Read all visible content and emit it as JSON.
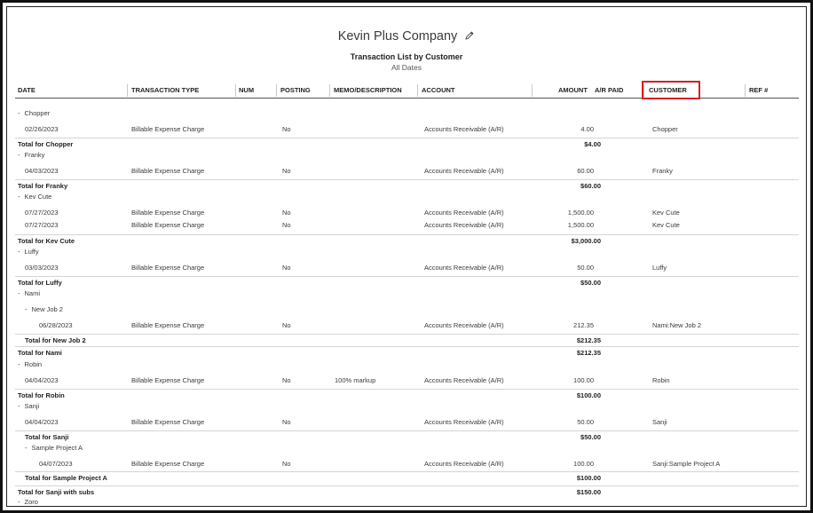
{
  "report": {
    "company": "Kevin Plus Company",
    "title": "Transaction List by Customer",
    "subtitle": "All Dates"
  },
  "columns": {
    "date": "DATE",
    "type": "TRANSACTION TYPE",
    "num": "NUM",
    "posting": "POSTING",
    "memo": "MEMO/DESCRIPTION",
    "account": "ACCOUNT",
    "amount": "AMOUNT",
    "ap": "A/R PAID",
    "customer": "CUSTOMER",
    "ref": "REF #"
  },
  "rows": [
    {
      "kind": "group",
      "indent": 0,
      "label": "Chopper"
    },
    {
      "kind": "txn",
      "indent": 0,
      "date": "02/26/2023",
      "type": "Billable Expense Charge",
      "posting": "No",
      "memo": "",
      "account": "Accounts Receivable (A/R)",
      "amount": "4.00",
      "customer": "Chopper"
    },
    {
      "kind": "total",
      "indent": 0,
      "label": "Total for Chopper",
      "amount": "$4.00"
    },
    {
      "kind": "group",
      "indent": 0,
      "label": "Franky"
    },
    {
      "kind": "txn",
      "indent": 0,
      "date": "04/03/2023",
      "type": "Billable Expense Charge",
      "posting": "No",
      "memo": "",
      "account": "Accounts Receivable (A/R)",
      "amount": "60.00",
      "customer": "Franky"
    },
    {
      "kind": "total",
      "indent": 0,
      "label": "Total for Franky",
      "amount": "$60.00"
    },
    {
      "kind": "group",
      "indent": 0,
      "label": "Kev Cute"
    },
    {
      "kind": "txn",
      "indent": 0,
      "date": "07/27/2023",
      "type": "Billable Expense Charge",
      "posting": "No",
      "memo": "",
      "account": "Accounts Receivable (A/R)",
      "amount": "1,500.00",
      "customer": "Kev Cute"
    },
    {
      "kind": "txn",
      "indent": 0,
      "date": "07/27/2023",
      "type": "Billable Expense Charge",
      "posting": "No",
      "memo": "",
      "account": "Accounts Receivable (A/R)",
      "amount": "1,500.00",
      "customer": "Kev Cute"
    },
    {
      "kind": "total",
      "indent": 0,
      "label": "Total for Kev Cute",
      "amount": "$3,000.00"
    },
    {
      "kind": "group",
      "indent": 0,
      "label": "Luffy"
    },
    {
      "kind": "txn",
      "indent": 0,
      "date": "03/03/2023",
      "type": "Billable Expense Charge",
      "posting": "No",
      "memo": "",
      "account": "Accounts Receivable (A/R)",
      "amount": "50.00",
      "customer": "Luffy"
    },
    {
      "kind": "total",
      "indent": 0,
      "label": "Total for Luffy",
      "amount": "$50.00"
    },
    {
      "kind": "group",
      "indent": 0,
      "label": "Nami"
    },
    {
      "kind": "group",
      "indent": 1,
      "label": "New Job 2"
    },
    {
      "kind": "txn",
      "indent": 1,
      "date": "06/28/2023",
      "type": "Billable Expense Charge",
      "posting": "No",
      "memo": "",
      "account": "Accounts Receivable (A/R)",
      "amount": "212.35",
      "customer": "Nami:New Job 2"
    },
    {
      "kind": "total",
      "indent": 1,
      "label": "Total for New Job 2",
      "amount": "$212.35"
    },
    {
      "kind": "total",
      "indent": 0,
      "label": "Total for Nami",
      "amount": "$212.35"
    },
    {
      "kind": "group",
      "indent": 0,
      "label": "Robin"
    },
    {
      "kind": "txn",
      "indent": 0,
      "date": "04/04/2023",
      "type": "Billable Expense Charge",
      "posting": "No",
      "memo": "100% markup",
      "account": "Accounts Receivable (A/R)",
      "amount": "100.00",
      "customer": "Robin"
    },
    {
      "kind": "total",
      "indent": 0,
      "label": "Total for Robin",
      "amount": "$100.00"
    },
    {
      "kind": "group",
      "indent": 0,
      "label": "Sanji"
    },
    {
      "kind": "txn",
      "indent": 0,
      "date": "04/04/2023",
      "type": "Billable Expense Charge",
      "posting": "No",
      "memo": "",
      "account": "Accounts Receivable (A/R)",
      "amount": "50.00",
      "customer": "Sanji"
    },
    {
      "kind": "total",
      "indent": 1,
      "label": "Total for Sanji",
      "amount": "$50.00"
    },
    {
      "kind": "group",
      "indent": 1,
      "label": "Sample Project A"
    },
    {
      "kind": "txn",
      "indent": 1,
      "date": "04/07/2023",
      "type": "Billable Expense Charge",
      "posting": "No",
      "memo": "",
      "account": "Accounts Receivable (A/R)",
      "amount": "100.00",
      "customer": "Sanji:Sample Project A"
    },
    {
      "kind": "total",
      "indent": 1,
      "label": "Total for Sample Project A",
      "amount": "$100.00"
    },
    {
      "kind": "total",
      "indent": 0,
      "label": "Total for Sanji with subs",
      "amount": "$150.00"
    },
    {
      "kind": "group",
      "indent": 0,
      "label": "Zoro"
    }
  ],
  "icons": {
    "edit": "pencil-icon",
    "toggle": "collapse-toggle-icon"
  },
  "colors": {
    "highlight": "#d61f26",
    "text": "#393a3d"
  }
}
